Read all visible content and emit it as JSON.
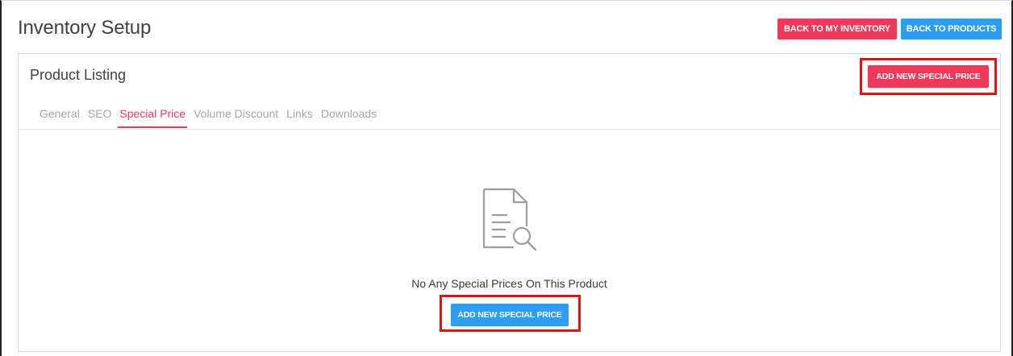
{
  "page": {
    "title": "Inventory Setup"
  },
  "header_buttons": {
    "back_to_inventory": "BACK TO MY INVENTORY",
    "back_to_products": "BACK TO PRODUCTS"
  },
  "card": {
    "title": "Product Listing",
    "add_button_label": "ADD NEW SPECIAL PRICE",
    "tabs": [
      {
        "label": "General",
        "active": false
      },
      {
        "label": "SEO",
        "active": false
      },
      {
        "label": "Special Price",
        "active": true
      },
      {
        "label": "Volume Discount",
        "active": false
      },
      {
        "label": "Links",
        "active": false
      },
      {
        "label": "Downloads",
        "active": false
      }
    ]
  },
  "empty_state": {
    "icon": "document-search-icon",
    "message": "No Any Special Prices On This Product",
    "button_label": "ADD NEW SPECIAL PRICE"
  },
  "colors": {
    "accent_red": "#f0385a",
    "accent_blue": "#2c9ef2",
    "highlight": "#e01414"
  }
}
